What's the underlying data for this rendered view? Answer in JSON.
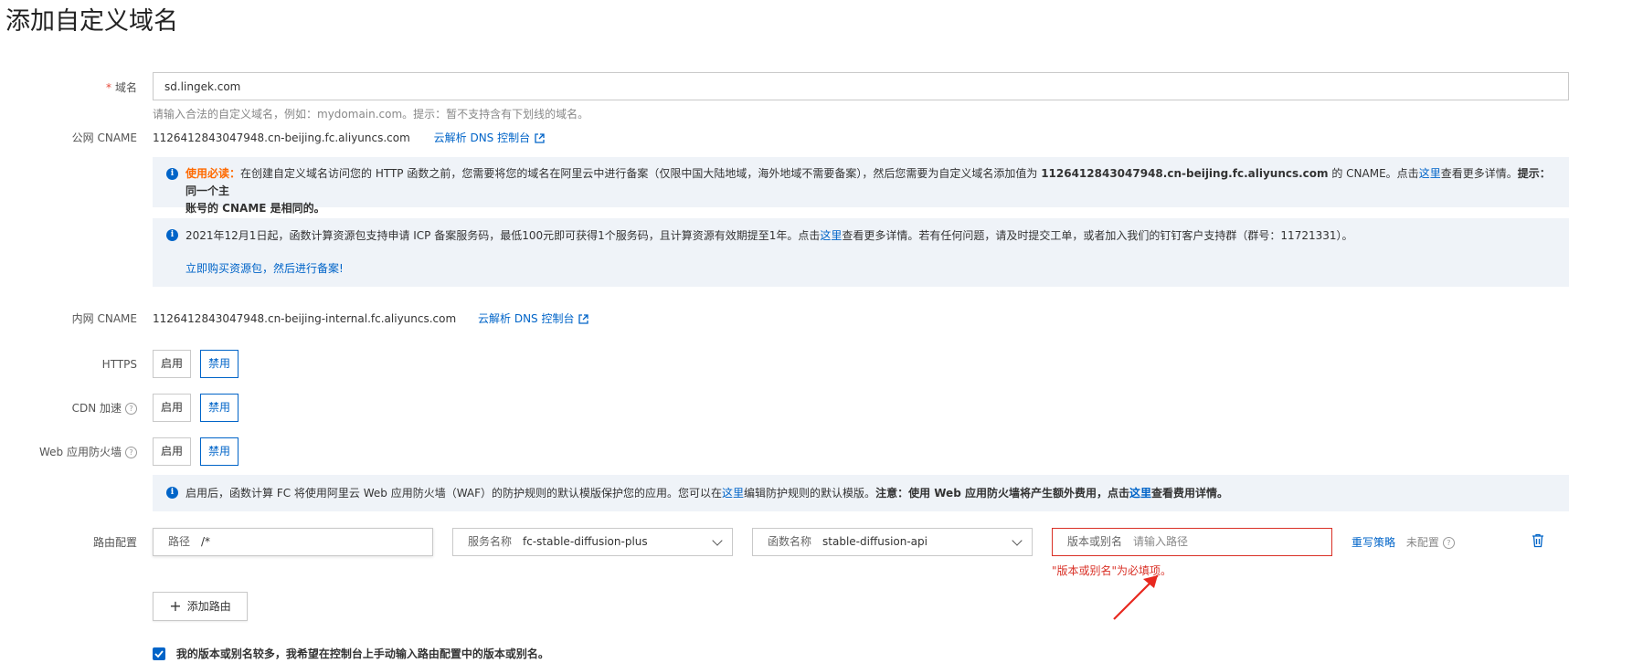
{
  "page_title": "添加自定义域名",
  "domain": {
    "required_mark": "*",
    "label": "域名",
    "value": "sd.lingek.com",
    "hint": "请输入合法的自定义域名，例如：mydomain.com。提示：暂不支持含有下划线的域名。"
  },
  "public_cname": {
    "label": "公网 CNAME",
    "value": "1126412843047948.cn-beijing.fc.aliyuncs.com",
    "link": "云解析 DNS 控制台"
  },
  "notice1": {
    "lead": "使用必读：",
    "p1": "在创建自定义域名访问您的 HTTP 函数之前，您需要将您的域名在阿里云中进行备案（仅限中国大陆地域，海外地域不需要备案），然后您需要为自定义域名添加值为 ",
    "cname": "1126412843047948.cn-beijing.fc.aliyuncs.com",
    "p2": " 的 CNAME。点击",
    "link": "这里",
    "p3": "查看更多详情。",
    "tip": "提示：同一个主",
    "tip2": "账号的 CNAME 是相同的。"
  },
  "notice2": {
    "p1": "2021年12月1日起，函数计算资源包支持申请 ICP 备案服务码，最低100元即可获得1个服务码，且计算资源有效期提至1年。点击",
    "link": "这里",
    "p2": "查看更多详情。若有任何问题，请及时提交工单，或者加入我们的钉钉客户支持群（群号：11721331）。",
    "buy_link": "立即购买资源包，然后进行备案!"
  },
  "internal_cname": {
    "label": "内网 CNAME",
    "value": "1126412843047948.cn-beijing-internal.fc.aliyuncs.com",
    "link": "云解析 DNS 控制台"
  },
  "toggles": {
    "enable": "启用",
    "disable": "禁用",
    "https_label": "HTTPS",
    "cdn_label": "CDN 加速",
    "waf_label": "Web 应用防火墙"
  },
  "notice3": {
    "p1": "启用后，函数计算 FC 将使用阿里云 Web 应用防火墙（WAF）的防护规则的默认模版保护您的应用。您可以在",
    "link": "这里",
    "p2": "编辑防护规则的默认模版。",
    "warn": "注意：使用 Web 应用防火墙将产生额外费用，点击",
    "link2": "这里",
    "warn2": "查看费用详情。"
  },
  "route": {
    "label": "路由配置",
    "path_prefix": "路径",
    "path_value": "/*",
    "service_prefix": "服务名称",
    "service_value": "fc-stable-diffusion-plus",
    "function_prefix": "函数名称",
    "function_value": "stable-diffusion-api",
    "version_prefix": "版本或别名",
    "version_placeholder": "请输入路径",
    "rewrite_link": "重写策略",
    "rewrite_status": "未配置",
    "error": "\"版本或别名\"为必填项。",
    "add_button": "添加路由"
  },
  "checkbox_text": "我的版本或别名较多，我希望在控制台上手动输入路由配置中的版本或别名。",
  "colors": {
    "accent": "#0064c8",
    "error": "#d93026",
    "warning": "#ff6a00",
    "notice_bg": "#eff3f8"
  },
  "icons": [
    "info-icon",
    "external-link-icon",
    "help-icon",
    "chevron-down-icon",
    "trash-icon",
    "plus-icon",
    "check-icon",
    "arrow-annotation"
  ]
}
